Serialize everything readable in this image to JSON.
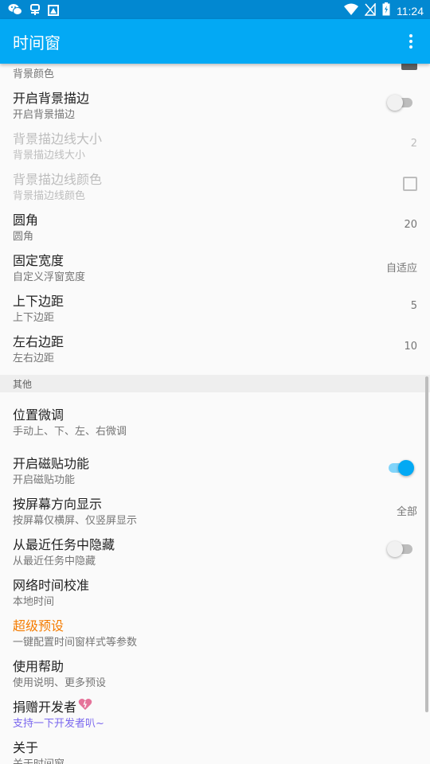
{
  "status_bar": {
    "time": "11:24",
    "icons": [
      "wechat-icon",
      "bug-icon",
      "image-icon",
      "wifi-icon",
      "no-sim-icon",
      "battery-charging-icon"
    ]
  },
  "app_bar": {
    "title": "时间窗",
    "menu_icon": "more-vert-icon"
  },
  "items": {
    "bg_color": {
      "subtitle": "背景颜色"
    },
    "bg_stroke": {
      "title": "开启背景描边",
      "subtitle": "开启背景描边",
      "switch_on": false
    },
    "stroke_size": {
      "title": "背景描边线大小",
      "subtitle": "背景描边线大小",
      "value": "2"
    },
    "stroke_color": {
      "title": "背景描边线颜色",
      "subtitle": "背景描边线颜色"
    },
    "corner": {
      "title": "圆角",
      "subtitle": "圆角",
      "value": "20"
    },
    "fixed_width": {
      "title": "固定宽度",
      "subtitle": "自定义浮窗宽度",
      "value": "自适应"
    },
    "vertical_margin": {
      "title": "上下边距",
      "subtitle": "上下边距",
      "value": "5"
    },
    "horizontal_margin": {
      "title": "左右边距",
      "subtitle": "左右边距",
      "value": "10"
    }
  },
  "section_other": {
    "label": "其他"
  },
  "other_items": {
    "position_adjust": {
      "title": "位置微调",
      "subtitle": "手动上、下、左、右微调"
    },
    "magnet": {
      "title": "开启磁贴功能",
      "subtitle": "开启磁贴功能",
      "switch_on": true
    },
    "orientation": {
      "title": "按屏幕方向显示",
      "subtitle": "按屏幕仅横屏、仅竖屏显示",
      "value": "全部"
    },
    "hide_recents": {
      "title": "从最近任务中隐藏",
      "subtitle": "从最近任务中隐藏",
      "switch_on": false
    },
    "network_time": {
      "title": "网络时间校准",
      "subtitle": "本地时间"
    },
    "super_preset": {
      "title": "超级预设",
      "subtitle": "一键配置时间窗样式等参数",
      "title_color": "#F57C00"
    },
    "help": {
      "title": "使用帮助",
      "subtitle": "使用说明、更多预设"
    },
    "donate": {
      "title": "捐赠开发者",
      "title_icon": "sparkling-heart-icon",
      "subtitle": "支持一下开发者叭~",
      "subtitle_color": "#7B68EE"
    },
    "about": {
      "title": "关于",
      "subtitle": "关于时间窗"
    }
  },
  "colors": {
    "primary": "#03A9F4",
    "primary_dark": "#0288D1",
    "accent_orange": "#F57C00",
    "accent_purple": "#7B68EE"
  }
}
